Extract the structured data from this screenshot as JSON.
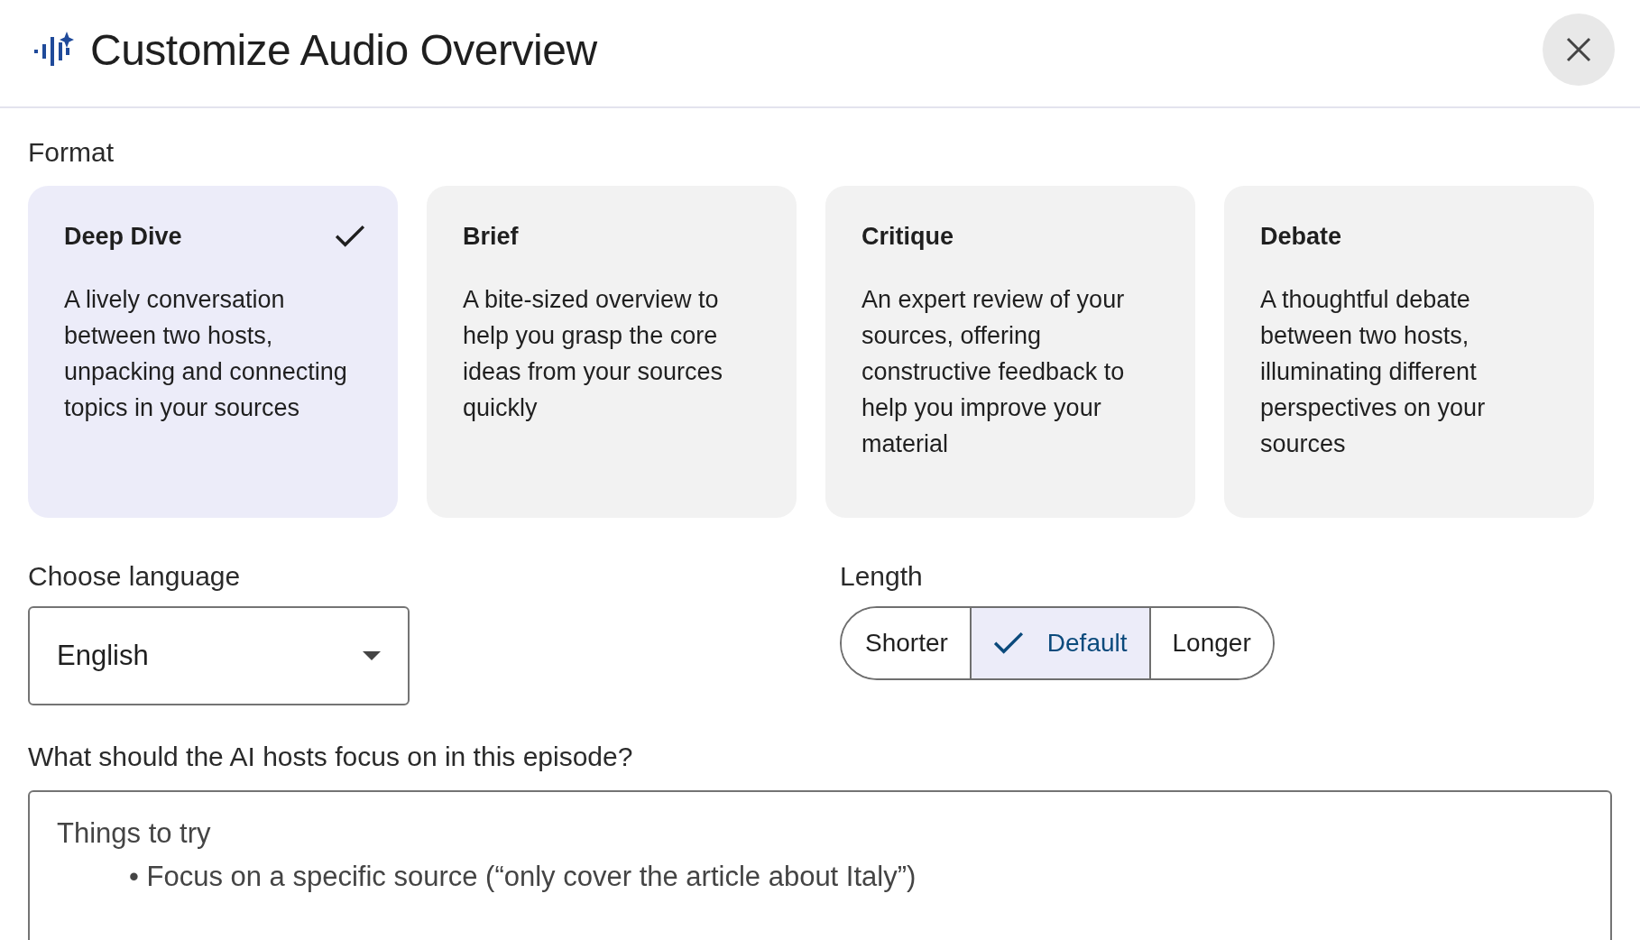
{
  "dialog": {
    "title": "Customize Audio Overview"
  },
  "format": {
    "label": "Format",
    "options": [
      {
        "title": "Deep Dive",
        "description": "A lively conversation between two hosts, unpacking and connecting topics in your sources",
        "selected": true
      },
      {
        "title": "Brief",
        "description": "A bite-sized overview to help you grasp the core ideas from your sources quickly",
        "selected": false
      },
      {
        "title": "Critique",
        "description": "An expert review of your sources, offering constructive feedback to help you improve your material",
        "selected": false
      },
      {
        "title": "Debate",
        "description": "A thoughtful debate between two hosts, illuminating different perspectives on your sources",
        "selected": false
      }
    ]
  },
  "language": {
    "label": "Choose language",
    "value": "English"
  },
  "length": {
    "label": "Length",
    "options": [
      {
        "label": "Shorter",
        "selected": false
      },
      {
        "label": "Default",
        "selected": true
      },
      {
        "label": "Longer",
        "selected": false
      }
    ]
  },
  "focus": {
    "label": "What should the AI hosts focus on in this episode?",
    "placeholder": "Things to try",
    "bullet": "•",
    "examples": [
      "Focus on a specific source (“only cover the article about Italy”)"
    ]
  }
}
